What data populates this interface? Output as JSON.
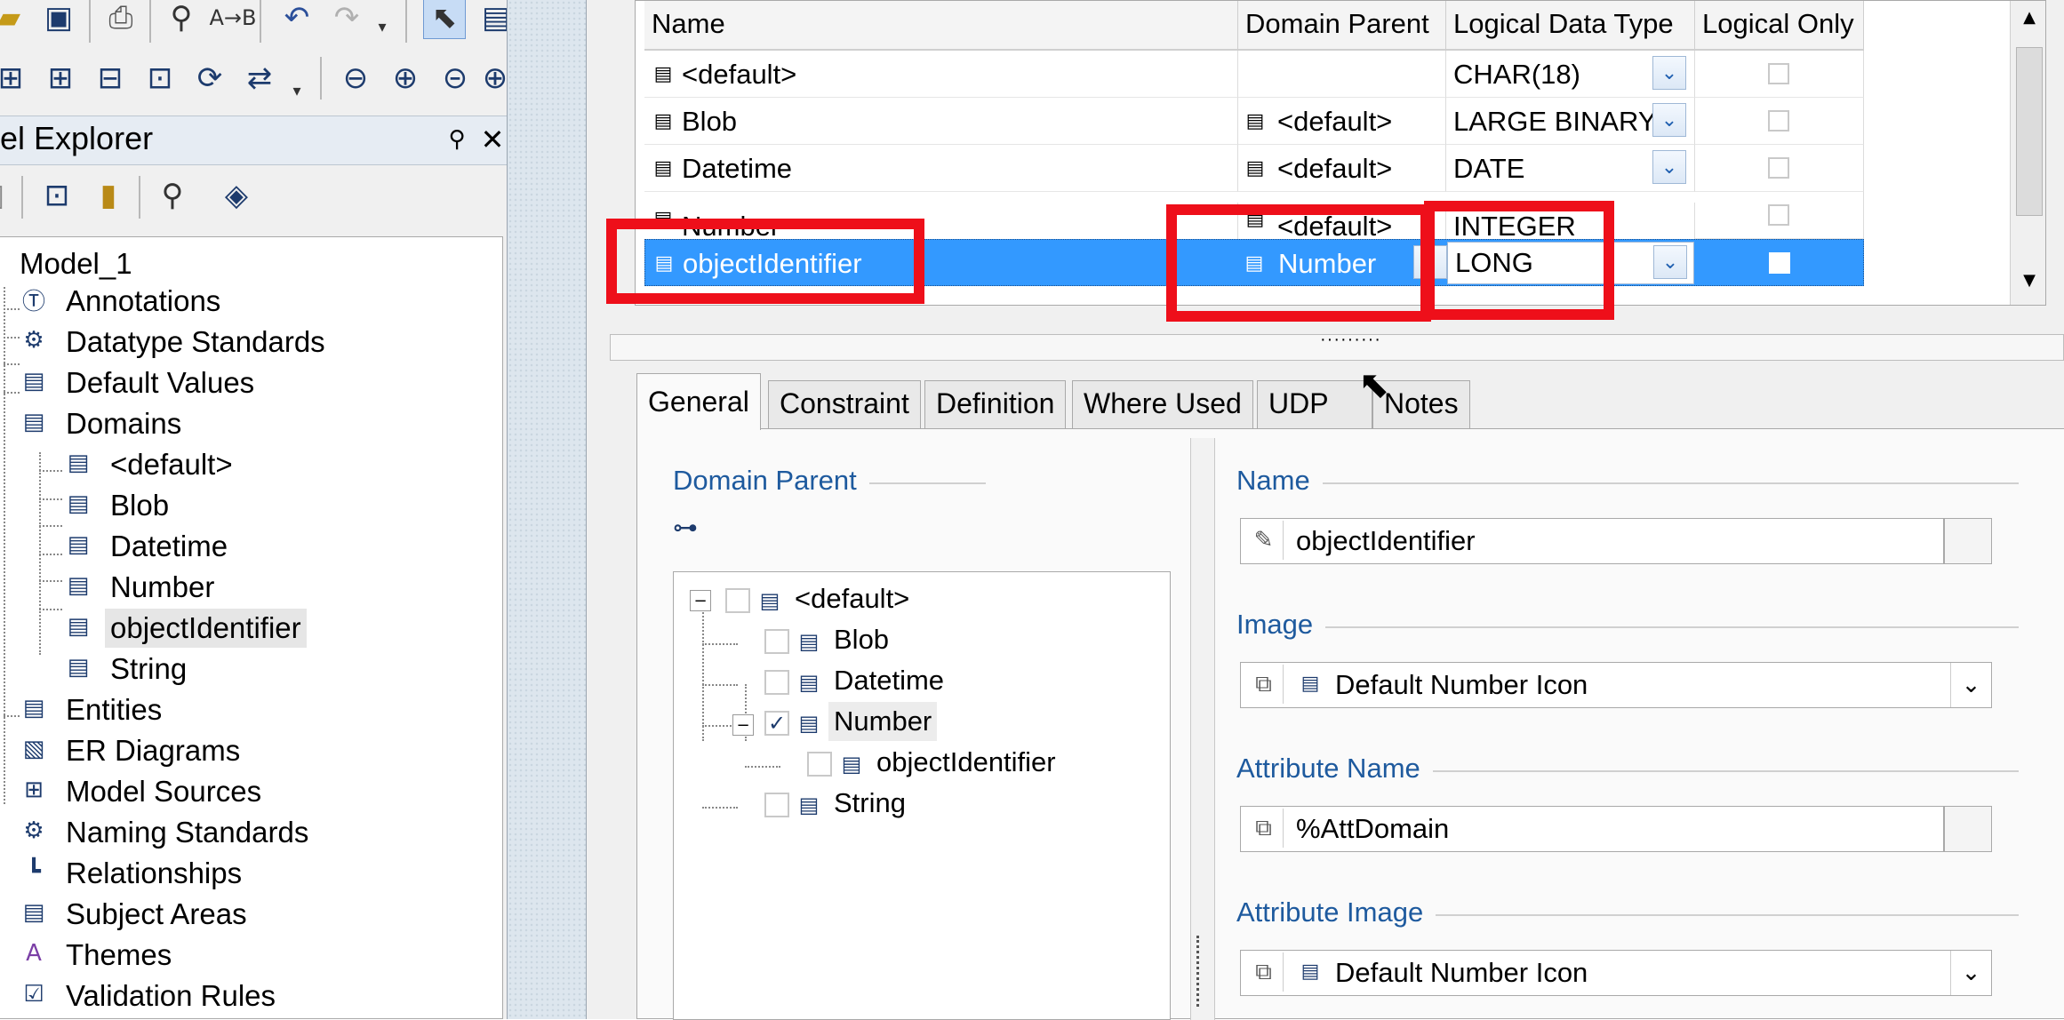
{
  "model_explorer": {
    "title": "el Explorer",
    "tree": {
      "root": "Model_1",
      "items": [
        {
          "label": "Annotations"
        },
        {
          "label": "Datatype Standards"
        },
        {
          "label": "Default Values"
        },
        {
          "label": "Domains"
        },
        {
          "label": "<default>"
        },
        {
          "label": "Blob"
        },
        {
          "label": "Datetime"
        },
        {
          "label": "Number"
        },
        {
          "label": "objectIdentifier"
        },
        {
          "label": "String"
        },
        {
          "label": "Entities"
        },
        {
          "label": "ER Diagrams"
        },
        {
          "label": "Model Sources"
        },
        {
          "label": "Naming Standards"
        },
        {
          "label": "Relationships"
        },
        {
          "label": "Subject Areas"
        },
        {
          "label": "Themes"
        },
        {
          "label": "Validation Rules"
        }
      ]
    }
  },
  "grid": {
    "columns": [
      "Name",
      "Domain Parent",
      "Logical Data Type",
      "Logical Only"
    ],
    "rows": [
      {
        "name": "<default>",
        "parent": "",
        "type": "CHAR(18)"
      },
      {
        "name": "Blob",
        "parent": "<default>",
        "type": "LARGE BINARY"
      },
      {
        "name": "Datetime",
        "parent": "<default>",
        "type": "DATE"
      },
      {
        "name": "Number",
        "parent": "<default>",
        "type": "INTEGER"
      },
      {
        "name": "objectIdentifier",
        "parent": "Number",
        "type": "LONG"
      }
    ]
  },
  "tabs": [
    "General",
    "Constraint",
    "Definition",
    "Where Used",
    "UDP",
    "Notes"
  ],
  "general": {
    "domain_parent_label": "Domain Parent",
    "parent_tree": [
      {
        "label": "<default>"
      },
      {
        "label": "Blob"
      },
      {
        "label": "Datetime"
      },
      {
        "label": "Number"
      },
      {
        "label": "objectIdentifier"
      },
      {
        "label": "String"
      }
    ],
    "name_label": "Name",
    "name_value": "objectIdentifier",
    "image_label": "Image",
    "image_value": "Default Number Icon",
    "attr_name_label": "Attribute Name",
    "attr_name_value": "%AttDomain",
    "attr_image_label": "Attribute Image",
    "attr_image_value": "Default Number Icon"
  },
  "colors": {
    "selection": "#3399ff",
    "highlight_box": "#ee0f1a",
    "label_blue": "#1e5a9e"
  }
}
